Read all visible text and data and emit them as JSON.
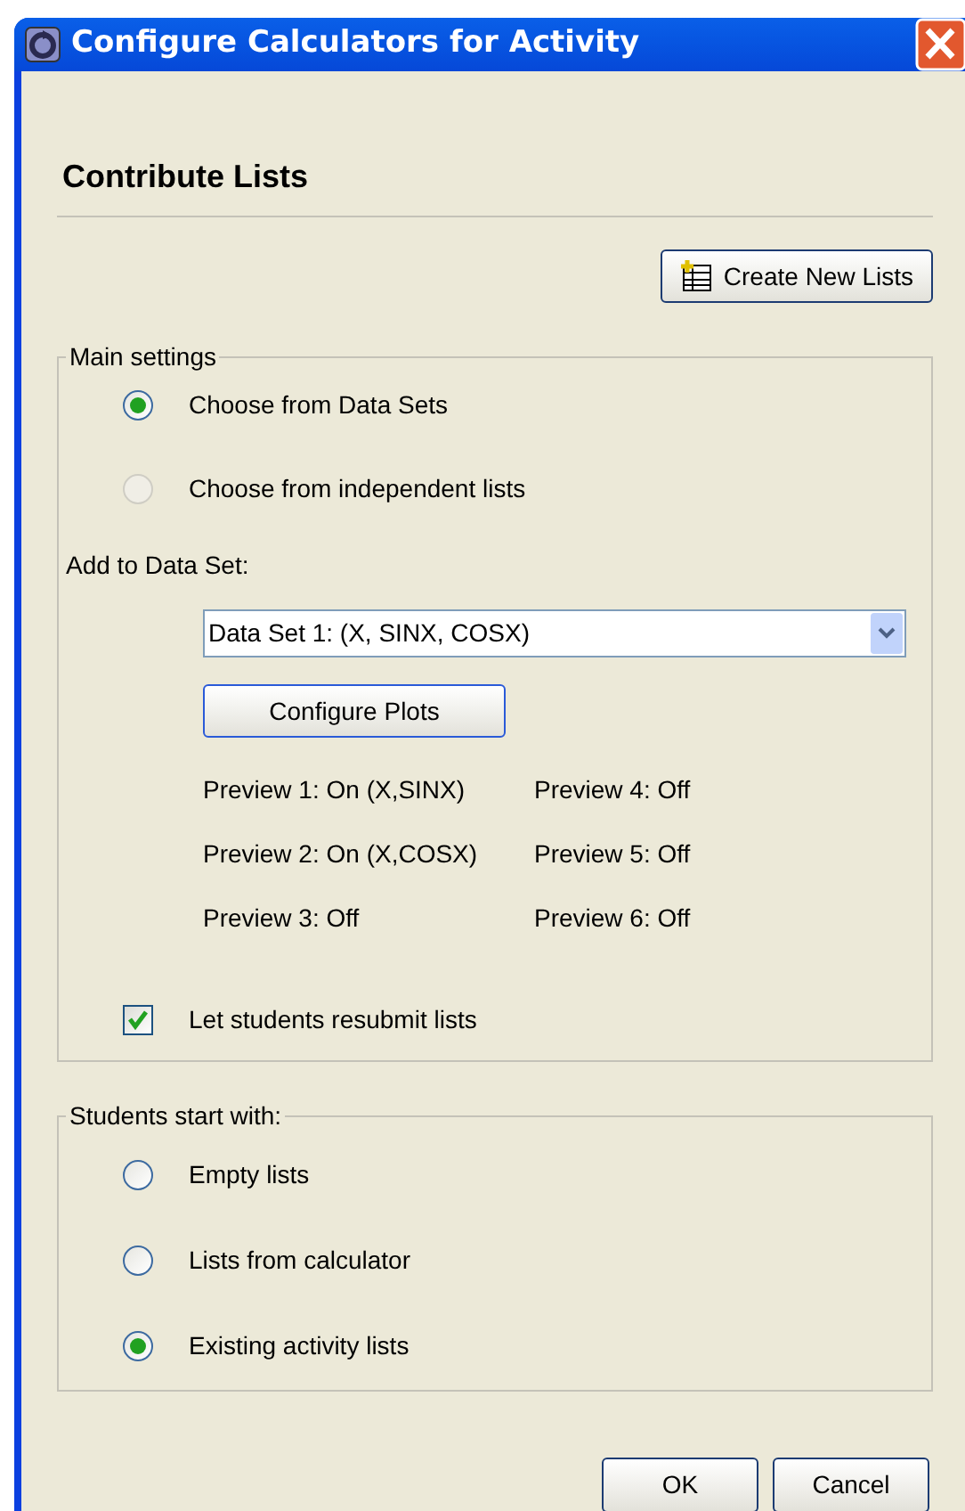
{
  "window": {
    "title": "Configure Calculators for Activity"
  },
  "heading": "Contribute Lists",
  "create_button": "Create New Lists",
  "main_settings": {
    "legend": "Main settings",
    "options": [
      {
        "label": "Choose from Data Sets",
        "selected": true,
        "disabled": false
      },
      {
        "label": "Choose from independent lists",
        "selected": false,
        "disabled": true
      }
    ],
    "data_set_label": "Add to Data Set:",
    "data_set_value": "Data Set 1: (X, SINX, COSX)",
    "configure_button": "Configure Plots",
    "previews": [
      "Preview 1: On (X,SINX)",
      "Preview 4: Off",
      "Preview 2: On (X,COSX)",
      "Preview 5: Off",
      "Preview 3: Off",
      "Preview 6: Off"
    ],
    "resubmit": {
      "label": "Let students resubmit lists",
      "checked": true
    }
  },
  "start_with": {
    "legend": "Students start with:",
    "options": [
      {
        "label": "Empty lists",
        "selected": false
      },
      {
        "label": "Lists from calculator",
        "selected": false
      },
      {
        "label": "Existing activity lists",
        "selected": true
      }
    ]
  },
  "buttons": [
    "OK",
    "Cancel"
  ]
}
